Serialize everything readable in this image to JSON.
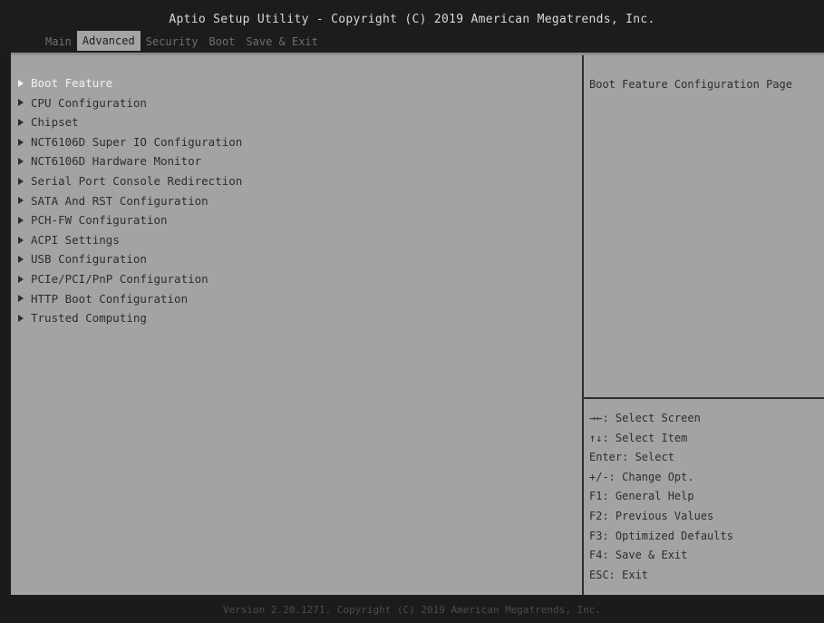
{
  "header": {
    "title": "Aptio Setup Utility - Copyright (C) 2019 American Megatrends, Inc.",
    "tabs": [
      "Main",
      "Advanced",
      "Security",
      "Boot",
      "Save & Exit"
    ],
    "active_tab": "Advanced"
  },
  "menu": {
    "items": [
      "Boot Feature",
      "CPU Configuration",
      "Chipset",
      "NCT6106D Super IO Configuration",
      "NCT6106D Hardware Monitor",
      "Serial Port Console Redirection",
      "SATA And RST Configuration",
      "PCH-FW Configuration",
      "ACPI Settings",
      "USB Configuration",
      "PCIe/PCI/PnP Configuration",
      "HTTP Boot Configuration",
      "Trusted Computing"
    ],
    "selected": "Boot Feature"
  },
  "help": {
    "text": "Boot Feature Configuration Page"
  },
  "keys": [
    "→←: Select Screen",
    "↑↓: Select Item",
    "Enter: Select",
    "+/-: Change Opt.",
    "F1: General Help",
    "F2: Previous Values",
    "F3: Optimized Defaults",
    "F4: Save & Exit",
    "ESC: Exit"
  ],
  "footer": {
    "text": "Version 2.20.1271. Copyright (C) 2019 American Megatrends, Inc."
  }
}
